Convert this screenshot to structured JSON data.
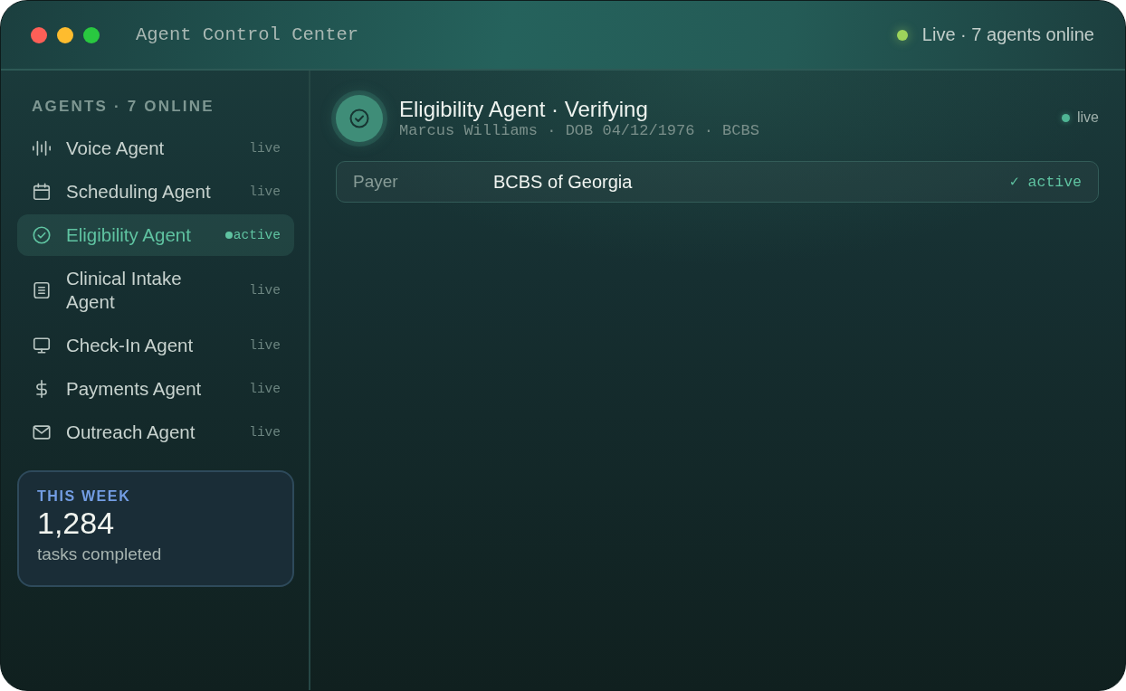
{
  "window": {
    "title": "Agent Control Center",
    "status": "Live · 7 agents online"
  },
  "sidebar": {
    "heading": "AGENTS · 7 ONLINE",
    "items": [
      {
        "label": "Voice Agent",
        "status": "live",
        "selected": false
      },
      {
        "label": "Scheduling Agent",
        "status": "live",
        "selected": false
      },
      {
        "label": "Eligibility Agent",
        "status": "active",
        "selected": true
      },
      {
        "label": "Clinical Intake Agent",
        "status": "live",
        "selected": false
      },
      {
        "label": "Check-In Agent",
        "status": "live",
        "selected": false
      },
      {
        "label": "Payments Agent",
        "status": "live",
        "selected": false
      },
      {
        "label": "Outreach Agent",
        "status": "live",
        "selected": false
      }
    ]
  },
  "stats": {
    "label": "THIS WEEK",
    "value": "1,284",
    "caption": "tasks completed"
  },
  "detail": {
    "title": "Eligibility Agent · Verifying",
    "subtitle": "Marcus Williams · DOB 04/12/1976 · BCBS",
    "status": "live",
    "fields": [
      {
        "label": "Payer",
        "value": "BCBS of Georgia",
        "status": "✓ active"
      }
    ]
  }
}
